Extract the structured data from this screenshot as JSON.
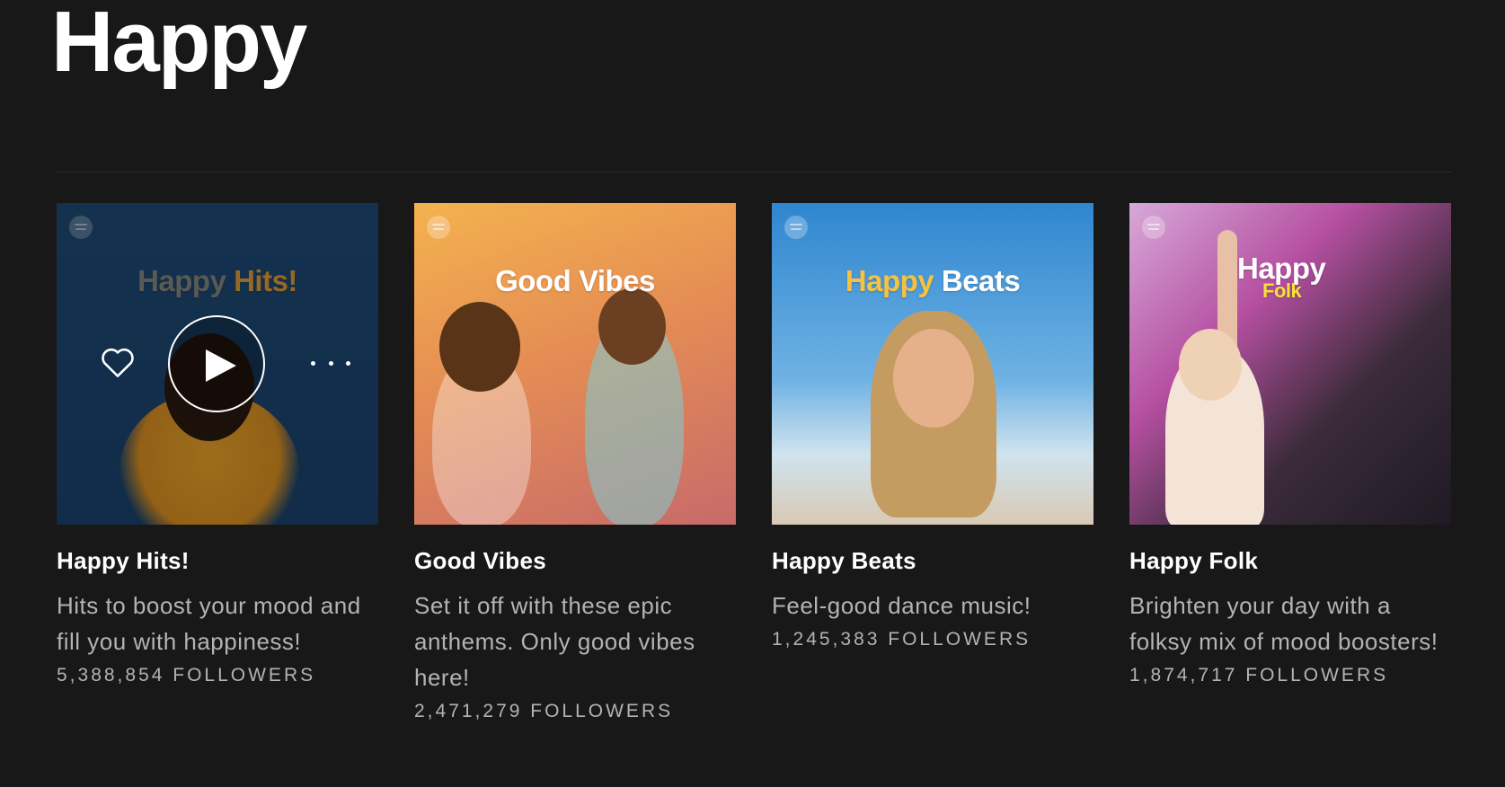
{
  "page": {
    "title": "Happy"
  },
  "playlists": [
    {
      "title": "Happy Hits!",
      "cover_word1": "Happy",
      "cover_word2": "Hits!",
      "description": "Hits to boost your mood and fill you with happiness!",
      "followers": "5,388,854 FOLLOWERS",
      "hovered": true
    },
    {
      "title": "Good Vibes",
      "cover_word1": "Good",
      "cover_word2": "Vibes",
      "description": "Set it off with these epic anthems. Only good vibes here!",
      "followers": "2,471,279 FOLLOWERS"
    },
    {
      "title": "Happy Beats",
      "cover_word1": "Happy",
      "cover_word2": "Beats",
      "description": "Feel-good dance music!",
      "followers": "1,245,383 FOLLOWERS"
    },
    {
      "title": "Happy Folk",
      "cover_word1": "Happy",
      "cover_word2": "Folk",
      "description": "Brighten your day with a folksy mix of mood boosters!",
      "followers": "1,874,717 FOLLOWERS"
    }
  ],
  "icons": {
    "heart": "heart-icon",
    "play": "play-icon",
    "more": "more-options-icon",
    "spotify": "spotify-logo-icon"
  },
  "colors": {
    "background": "#181818",
    "text_primary": "#ffffff",
    "text_secondary": "#b3b3b3"
  }
}
